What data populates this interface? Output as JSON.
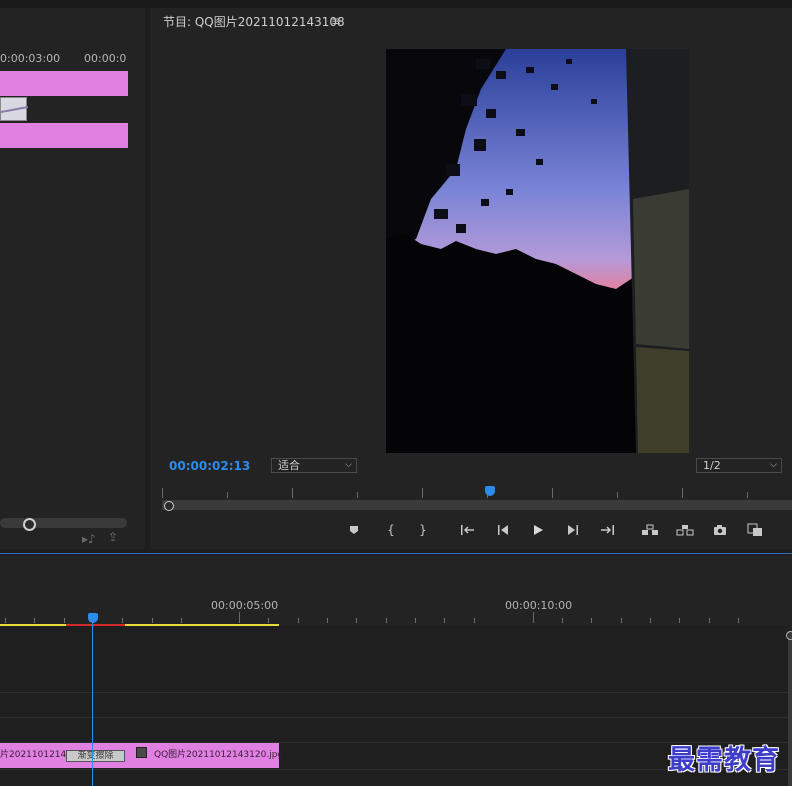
{
  "source_panel": {
    "ruler_labels": [
      "0:00:03:00",
      "00:00:0"
    ]
  },
  "program_monitor": {
    "title": "节目: QQ图片20211012143108",
    "menu_icon": "hamburger-icon",
    "current_timecode": "00:00:02:13",
    "fit_label": "适合",
    "resolution_label": "1/2",
    "controls": [
      "marker-icon",
      "in-point-icon",
      "out-point-icon",
      "go-to-in-icon",
      "step-back-icon",
      "play-icon",
      "step-forward-icon",
      "go-to-out-icon",
      "lift-icon",
      "extract-icon",
      "camera-icon",
      "multi-export-icon"
    ],
    "accent": "#2d8ceb"
  },
  "timeline": {
    "ruler_labels": [
      "00:00:05:00",
      "00:00:10:00"
    ],
    "clips": {
      "clip_a_label": "片2021101214",
      "transition_label": "渐变擦除",
      "clip_b_label": "QQ图片20211012143120.jpg"
    }
  },
  "watermark": "最需教育"
}
